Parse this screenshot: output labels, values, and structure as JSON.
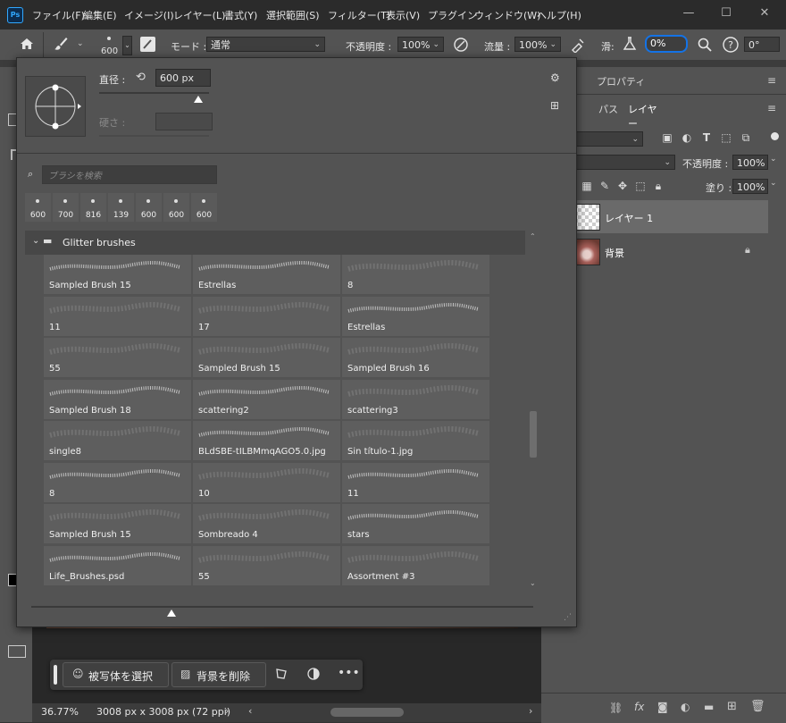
{
  "app": {
    "logo": "Ps"
  },
  "menubar": {
    "items": [
      "ファイル(F)",
      "編集(E)",
      "イメージ(I)",
      "レイヤー(L)",
      "書式(Y)",
      "選択範囲(S)",
      "フィルター(T)",
      "表示(V)",
      "プラグイン",
      "ウィンドウ(W)",
      "ヘルプ(H)"
    ]
  },
  "options": {
    "brush_size": "600",
    "mode_label": "モード :",
    "mode_value": "通常",
    "opacity_label": "不透明度 :",
    "opacity_value": "100%",
    "flow_label": "流量 :",
    "flow_value": "100%",
    "smoothing_label": "滑:",
    "smoothing_value": "0%",
    "angle_value": "0°"
  },
  "picker": {
    "diameter_label": "直径 :",
    "diameter_value": "600 px",
    "hardness_label": "硬さ :",
    "search_placeholder": "ブラシを検索",
    "recent_sizes": [
      "600",
      "700",
      "816",
      "139",
      "600",
      "600",
      "600"
    ],
    "folder_name": "Glitter brushes",
    "brushes": [
      "Sampled Brush 15",
      "Estrellas",
      "8",
      "11",
      "17",
      "Estrellas",
      "55",
      "Sampled Brush 15",
      "Sampled Brush 16",
      "Sampled Brush 18",
      "scattering2",
      "scattering3",
      "single8",
      "BLdSBE-tILBMmqAGO5.0.jpg",
      "Sin título-1.jpg",
      "8",
      "10",
      "11",
      "Sampled Brush 15",
      "Sombreado 4",
      "stars",
      "Life_Brushes.psd",
      "55",
      "Assortment #3"
    ]
  },
  "layers_panel": {
    "tabs_top": [
      "プロパティ"
    ],
    "tabs_second": [
      "パス",
      "レイヤー"
    ],
    "opacity_label": "不透明度 :",
    "opacity_value": "100%",
    "fill_label": "塗り :",
    "fill_value": "100%",
    "layers": [
      "レイヤー 1",
      "背景"
    ]
  },
  "taskbar": {
    "select_subject": "被写体を選択",
    "remove_bg": "背景を削除"
  },
  "status": {
    "zoom": "36.77%",
    "doc_info": "3008 px x 3008 px (72 ppi)"
  },
  "colors": {
    "accent": "#1473e6",
    "panel": "#535353",
    "menubar": "#2b2b2b"
  }
}
